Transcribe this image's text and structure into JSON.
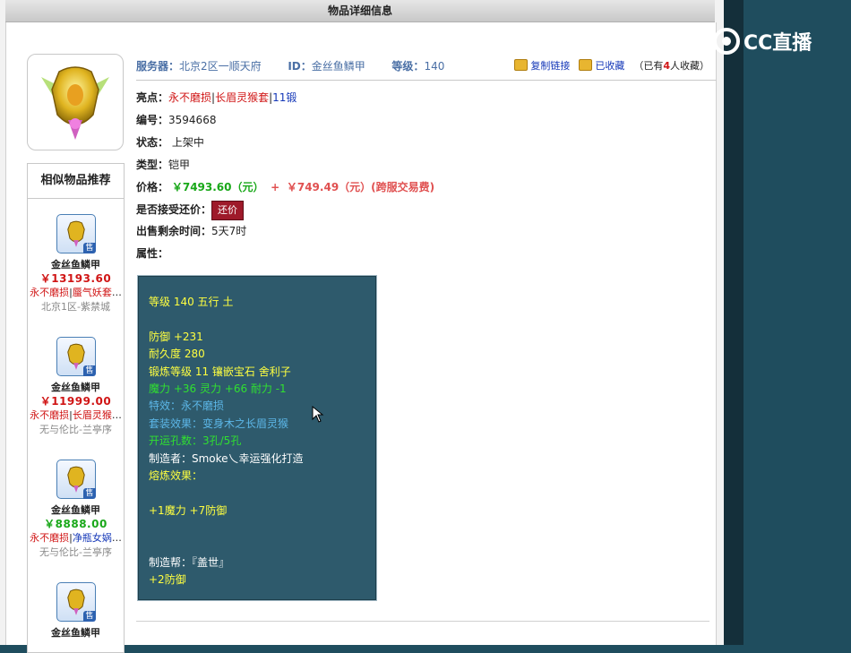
{
  "page_title": "物品详细信息",
  "header": {
    "server_label": "服务器：",
    "server_value": "北京2区一顺天府",
    "id_label": "ID：",
    "id_value": "金丝鱼鳞甲",
    "level_label": "等级：",
    "level_value": "140",
    "copy_link": "复制链接",
    "favorited": "已收藏",
    "fav_count_prefix": "（已有",
    "fav_count": "4",
    "fav_count_suffix": "人收藏）"
  },
  "details": {
    "highlights_label": "亮点：",
    "highlights": [
      "永不磨损",
      "长眉灵猴套",
      "11锻"
    ],
    "number_label": "编号：",
    "number_value": "3594668",
    "status_label": "状态：",
    "status_value": "上架中",
    "type_label": "类型：",
    "type_value": "铠甲",
    "price_label": "价格：",
    "price_main": "￥7493.60（元）",
    "price_plus": "+",
    "price_fee": "￥749.49（元）(跨服交易费)",
    "counter_label": "是否接受还价：",
    "counter_button": "还价",
    "time_label": "出售剩余时间：",
    "time_value": "5天7时",
    "attr_label": "属性："
  },
  "attributes": {
    "level_line": "等级 140 五行 土",
    "defense": "防御 +231",
    "durability": "耐久度 280",
    "forge": "锻炼等级 11 镶嵌宝石 舍利子",
    "stats": "魔力 +36 灵力 +66 耐力 -1",
    "effect": "特效：永不磨损",
    "set_effect": "套装效果：变身木之长眉灵猴",
    "slots": "开运孔数：3孔/5孔",
    "maker": "制造者：Smoke乀幸运强化打造",
    "melt_label": "熔炼效果：",
    "melt_value": "+1魔力 +7防御",
    "guild": "制造帮：『盖世』",
    "guild_bonus": "+2防御"
  },
  "similar": {
    "title": "相似物品推荐",
    "sell_tag": "售",
    "items": [
      {
        "name": "金丝鱼鳞甲",
        "price": "￥13193.60",
        "feat1": "永不磨损",
        "feat2": "蜃气妖套",
        "more": "…",
        "server": "北京1区-紫禁城"
      },
      {
        "name": "金丝鱼鳞甲",
        "price": "￥11999.00",
        "feat1": "永不磨损",
        "feat2": "长眉灵猴",
        "more": "…",
        "server": "无与伦比-兰亭序"
      },
      {
        "name": "金丝鱼鳞甲",
        "price": "￥8888.00",
        "feat1": "永不磨损",
        "feat2": "净瓶女娲",
        "more": "…",
        "server": "无与伦比-兰亭序"
      },
      {
        "name": "金丝鱼鳞甲",
        "price": "",
        "feat1": "",
        "feat2": "",
        "more": "",
        "server": ""
      }
    ]
  },
  "overlay": {
    "brand": "CC直播"
  },
  "colors": {
    "price_red": "#d01515",
    "price_green": "#19a819",
    "panel_bg": "#2e5a6c",
    "accent_blue": "#4a6fa5"
  }
}
